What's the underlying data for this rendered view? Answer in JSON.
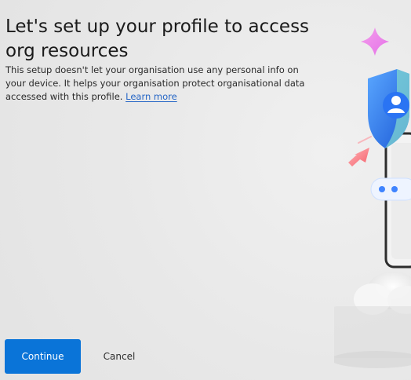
{
  "content": {
    "title": "Let's set up your profile to access org resources",
    "description": "This setup doesn't let your organisation use any personal info on your device. It helps your organisation protect organisational data accessed with this profile.",
    "learn_more": "Learn more"
  },
  "footer": {
    "continue_label": "Continue",
    "cancel_label": "Cancel"
  },
  "illustration": {
    "icons": [
      "sparkle-icon",
      "shield-user-icon",
      "cursor-arrow-icon",
      "password-dots-icon",
      "cloud-icon",
      "phone-device-icon"
    ],
    "password_mask": "* *"
  }
}
